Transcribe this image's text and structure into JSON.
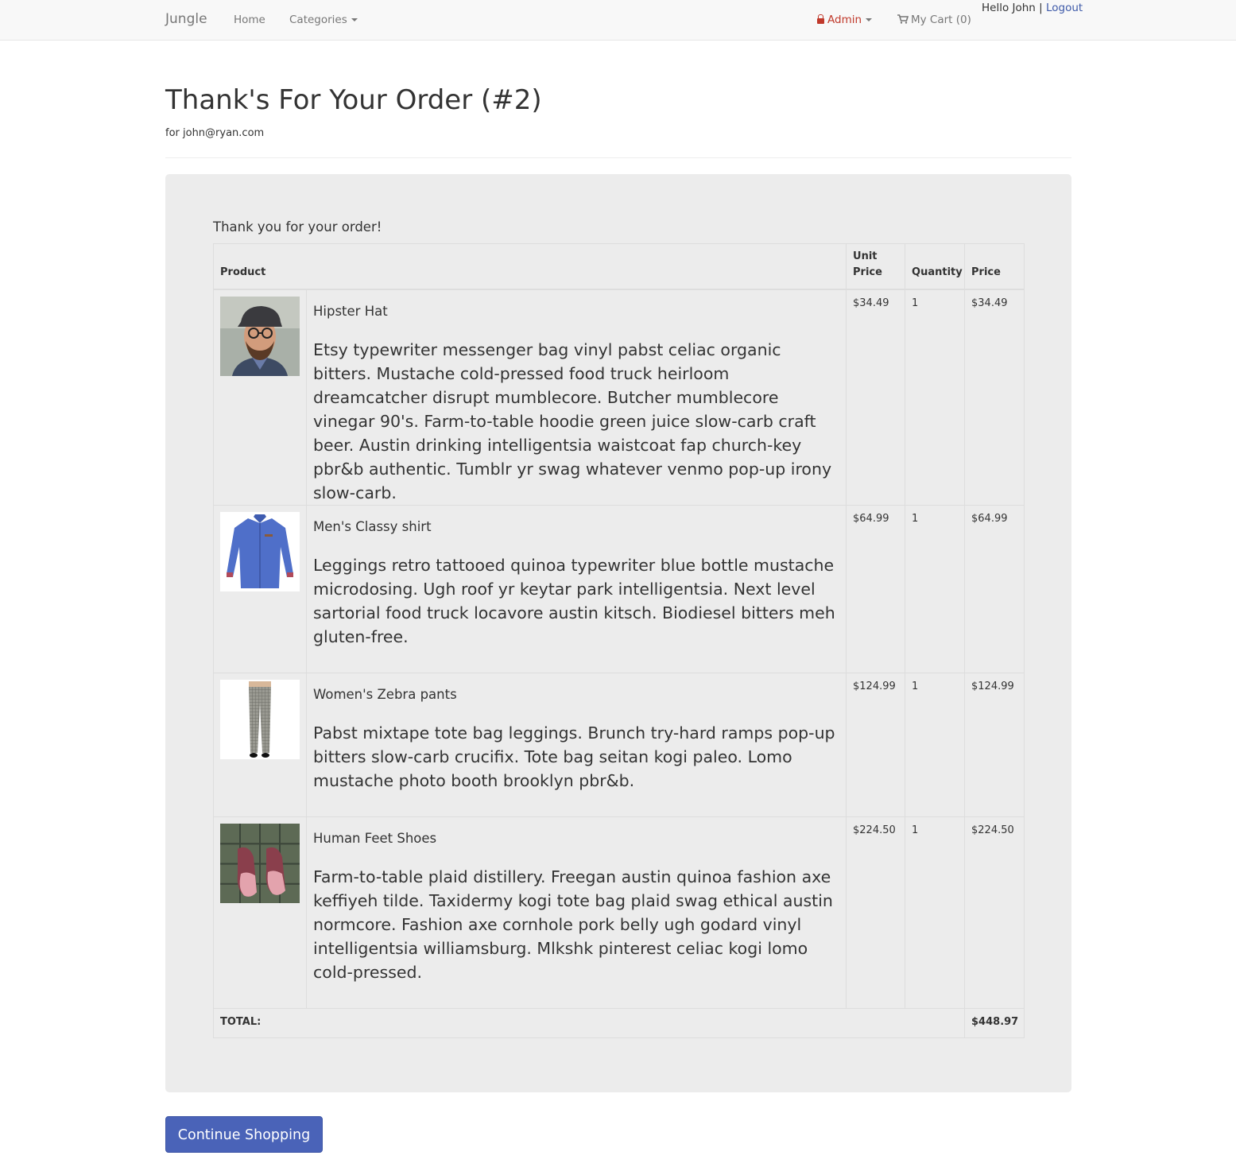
{
  "navbar": {
    "brand": "Jungle",
    "home": "Home",
    "categories": "Categories",
    "admin": "Admin",
    "cart": "My Cart (0)",
    "greeting": "Hello John |",
    "logout": "Logout"
  },
  "header": {
    "title": "Thank's For Your Order (#2)",
    "subtitle": "for john@ryan.com"
  },
  "order": {
    "intro": "Thank you for your order!",
    "columns": {
      "product": "Product",
      "unit_price": "Unit Price",
      "quantity": "Quantity",
      "price": "Price"
    },
    "items": [
      {
        "name": "Hipster Hat",
        "description": "Etsy typewriter messenger bag vinyl pabst celiac organic bitters. Mustache cold-pressed food truck heirloom dreamcatcher disrupt mumblecore. Butcher mumblecore vinegar 90's. Farm-to-table hoodie green juice slow-carb craft beer. Austin drinking intelligentsia waistcoat fap church-key pbr&b authentic. Tumblr yr swag whatever venmo pop-up irony slow-carb.",
        "unit_price": "$34.49",
        "quantity": "1",
        "price": "$34.49"
      },
      {
        "name": "Men's Classy shirt",
        "description": "Leggings retro tattooed quinoa typewriter blue bottle mustache microdosing. Ugh roof yr keytar park intelligentsia. Next level sartorial food truck locavore austin kitsch. Biodiesel bitters meh gluten-free.",
        "unit_price": "$64.99",
        "quantity": "1",
        "price": "$64.99"
      },
      {
        "name": "Women's Zebra pants",
        "description": "Pabst mixtape tote bag leggings. Brunch try-hard ramps pop-up bitters slow-carb crucifix. Tote bag seitan kogi paleo. Lomo mustache photo booth brooklyn pbr&b.",
        "unit_price": "$124.99",
        "quantity": "1",
        "price": "$124.99"
      },
      {
        "name": "Human Feet Shoes",
        "description": "Farm-to-table plaid distillery. Freegan austin quinoa fashion axe keffiyeh tilde. Taxidermy kogi tote bag plaid swag ethical austin normcore. Fashion axe cornhole pork belly ugh godard vinyl intelligentsia williamsburg. Mlkshk pinterest celiac kogi lomo cold-pressed.",
        "unit_price": "$224.50",
        "quantity": "1",
        "price": "$224.50"
      }
    ],
    "total_label": "TOTAL:",
    "total": "$448.97"
  },
  "actions": {
    "continue": "Continue Shopping"
  },
  "colors": {
    "accent": "#4a63b8",
    "link": "#3e5aa9",
    "admin": "#c0392b",
    "well": "#ececec"
  }
}
